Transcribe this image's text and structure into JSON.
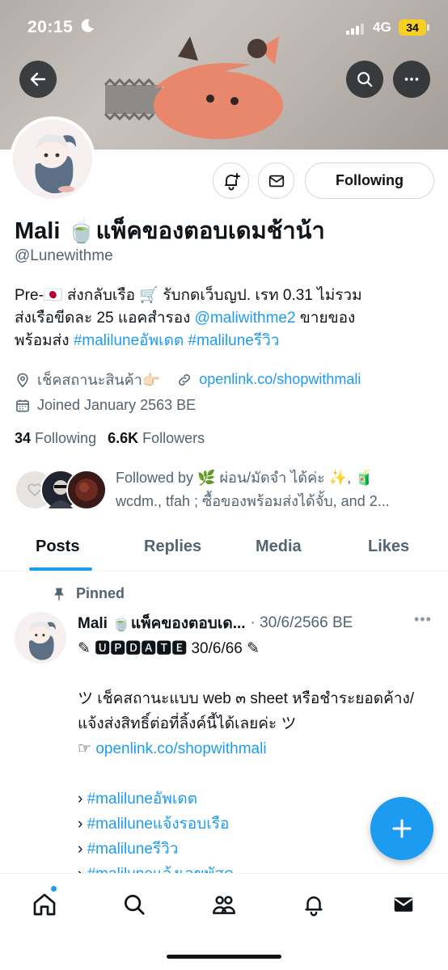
{
  "status_bar": {
    "time": "20:15",
    "network": "4G",
    "battery": "34"
  },
  "profile": {
    "name": "Mali 🍵แพ็คของตอบเดมช้าน้า",
    "handle": "@Lunewithme",
    "following_button": "Following",
    "bio": {
      "line1": "Pre-🇯🇵 ส่งกลับเรือ 🛒 รับกดเว็บญป. เรท 0.31 ไม่รวม",
      "line2_prefix": "ส่งเรือขีดละ 25 แอคสำรอง ",
      "line2_link": "@maliwithme2",
      "line2_suffix": " ขายของ",
      "line3_prefix": "พร้อมส่ง ",
      "line3_tag1": "#maliluneอัพเดต",
      "line3_tag2": "#maliluneรีวิว"
    },
    "location": "เช็คสถานะสินค้า👉🏻",
    "website": "openlink.co/shopwithmali",
    "joined": "Joined January 2563 BE",
    "following_count": "34",
    "following_label": "Following",
    "followers_count": "6.6K",
    "followers_label": "Followers",
    "followed_by_line1": "Followed by 🌿 ผ่อน/มัดจำ ได้ค่ะ ✨, 🧃",
    "followed_by_line2": "wcdm., tfah ; ซื้อของพร้อมส่งได้จั้บ, and 2..."
  },
  "tabs": [
    {
      "label": "Posts"
    },
    {
      "label": "Replies"
    },
    {
      "label": "Media"
    },
    {
      "label": "Likes"
    }
  ],
  "pinned_post": {
    "pinned_label": "Pinned",
    "author": "Mali 🍵แพ็คของตอบเด...",
    "date": "· 30/6/2566 BE",
    "line1": "✎ 🆄🅿🅳🅰🆃🅴 30/6/66 ✎",
    "line2": "ツ เช็คสถานะแบบ web ๓ sheet หรือชำระยอดค้าง/แจ้งส่งสิทธิ์ต่อที่ลิ้งค์นี้ได้เลยค่ะ ツ",
    "link_prefix": "☞ ",
    "link": "openlink.co/shopwithmali",
    "tags": [
      {
        "prefix": "› ",
        "tag": "#maliluneอัพเดต"
      },
      {
        "prefix": "› ",
        "tag": "#maliluneแจ้งรอบเรือ"
      },
      {
        "prefix": "› ",
        "tag": "#maliluneรีวิว"
      },
      {
        "prefix": "› ",
        "tag": "#maliluneแจ้งเลขพัสดุ"
      }
    ]
  },
  "colors": {
    "accent": "#1d9bf0",
    "text": "#0f1419",
    "muted": "#536471"
  }
}
